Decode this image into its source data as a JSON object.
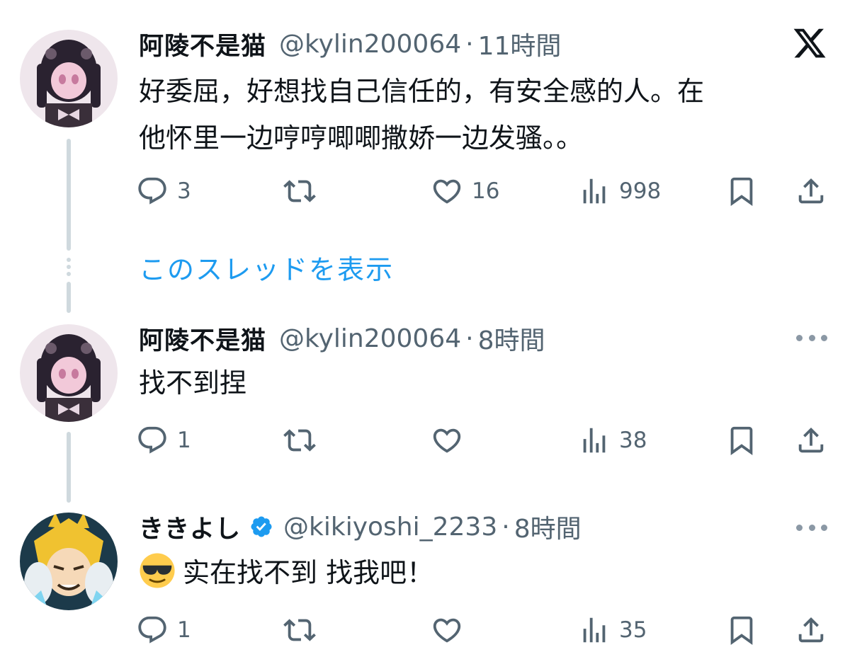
{
  "brand": {
    "logo": "X",
    "accent": "#1d9bf0"
  },
  "show_thread_label": "このスレッドを表示",
  "tweets": [
    {
      "name": "阿陵不是猫",
      "handle": "@kylin200064",
      "separator": "·",
      "time": "11時間",
      "text_line1": "好委屈，好想找自己信任的，有安全感的人。在",
      "text_line2": "他怀里一边哼哼唧唧撒娇一边发骚。。",
      "replies": "3",
      "reposts": "",
      "likes": "16",
      "views": "998"
    },
    {
      "name": "阿陵不是猫",
      "handle": "@kylin200064",
      "separator": "·",
      "time": "8時間",
      "text": "找不到捏",
      "replies": "1",
      "reposts": "",
      "likes": "",
      "views": "38"
    },
    {
      "name": "ききよし",
      "verified": true,
      "handle": "@kikiyoshi_2233",
      "separator": "·",
      "time": "8時間",
      "emoji": "smiling-face-with-sunglasses",
      "text": "实在找不到 找我吧！",
      "replies": "1",
      "reposts": "",
      "likes": "",
      "views": "35"
    }
  ]
}
